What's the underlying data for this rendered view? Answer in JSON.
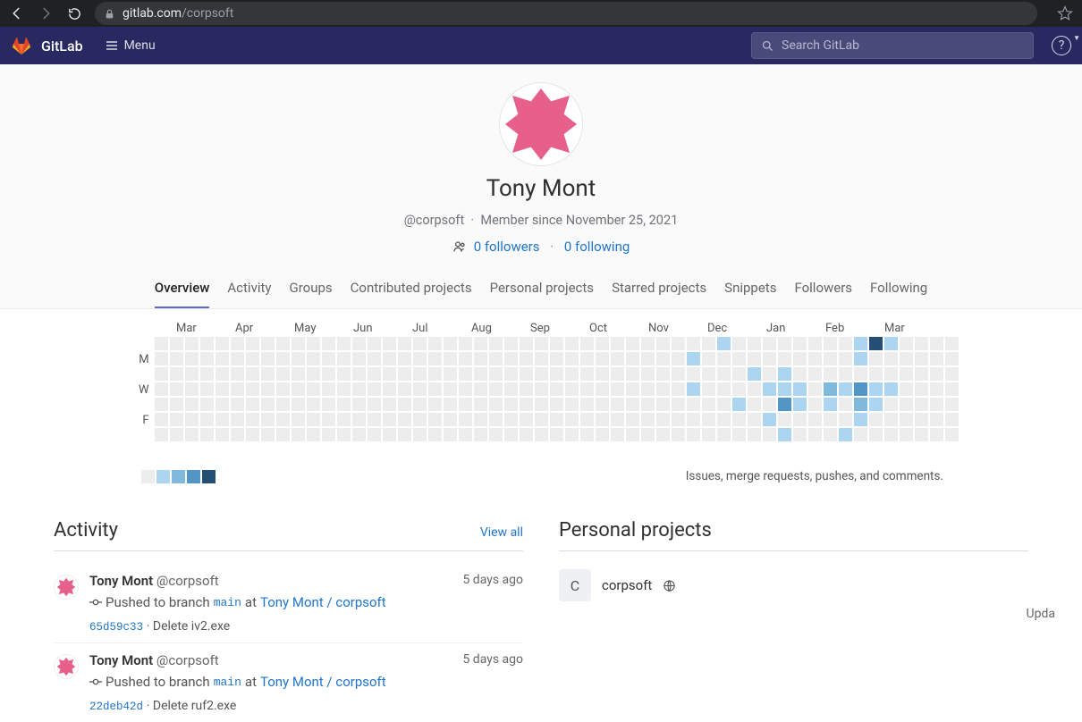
{
  "browser": {
    "url_host": "gitlab.com",
    "url_path": "/corpsoft"
  },
  "header": {
    "brand": "GitLab",
    "menu": "Menu",
    "search_placeholder": "Search GitLab"
  },
  "profile": {
    "name": "Tony Mont",
    "handle": "@corpsoft",
    "member_since": "Member since November 25, 2021",
    "followers_count": "0 followers",
    "following_count": "0 following"
  },
  "tabs": [
    "Overview",
    "Activity",
    "Groups",
    "Contributed projects",
    "Personal projects",
    "Starred projects",
    "Snippets",
    "Followers",
    "Following"
  ],
  "calendar": {
    "months": [
      "Mar",
      "Apr",
      "May",
      "Jun",
      "Jul",
      "Aug",
      "Sep",
      "Oct",
      "Nov",
      "Dec",
      "Jan",
      "Feb",
      "Mar"
    ],
    "day_labels": [
      "",
      "M",
      "",
      "W",
      "",
      "F",
      ""
    ],
    "legend_text": "Issues, merge requests, pushes, and comments.",
    "contribs": [
      [
        35,
        1,
        1
      ],
      [
        35,
        3,
        1
      ],
      [
        37,
        0,
        1
      ],
      [
        38,
        4,
        1
      ],
      [
        39,
        2,
        1
      ],
      [
        40,
        3,
        1
      ],
      [
        40,
        5,
        1
      ],
      [
        41,
        2,
        1
      ],
      [
        41,
        3,
        1
      ],
      [
        41,
        4,
        3
      ],
      [
        41,
        6,
        1
      ],
      [
        42,
        3,
        1
      ],
      [
        42,
        4,
        1
      ],
      [
        44,
        3,
        2
      ],
      [
        44,
        4,
        1
      ],
      [
        45,
        3,
        1
      ],
      [
        45,
        6,
        1
      ],
      [
        46,
        0,
        1
      ],
      [
        46,
        1,
        1
      ],
      [
        46,
        3,
        3
      ],
      [
        46,
        4,
        2
      ],
      [
        46,
        5,
        1
      ],
      [
        47,
        0,
        4
      ],
      [
        47,
        3,
        1
      ],
      [
        47,
        4,
        1
      ],
      [
        48,
        0,
        1
      ],
      [
        48,
        3,
        1
      ]
    ],
    "legend_scale": [
      0,
      1,
      2,
      3,
      4
    ]
  },
  "activity": {
    "title": "Activity",
    "view_all": "View all",
    "items": [
      {
        "author": "Tony Mont",
        "handle": "@corpsoft",
        "time": "5 days ago",
        "action": "Pushed to branch",
        "branch": "main",
        "at": "at",
        "project": "Tony Mont / corpsoft",
        "sha": "65d59c33",
        "desc": "Delete iv2.exe"
      },
      {
        "author": "Tony Mont",
        "handle": "@corpsoft",
        "time": "5 days ago",
        "action": "Pushed to branch",
        "branch": "main",
        "at": "at",
        "project": "Tony Mont / corpsoft",
        "sha": "22deb42d",
        "desc": "Delete ruf2.exe"
      }
    ]
  },
  "personal_projects": {
    "title": "Personal projects",
    "items": [
      {
        "letter": "C",
        "name": "corpsoft"
      }
    ],
    "truncated_right": "Upda"
  }
}
